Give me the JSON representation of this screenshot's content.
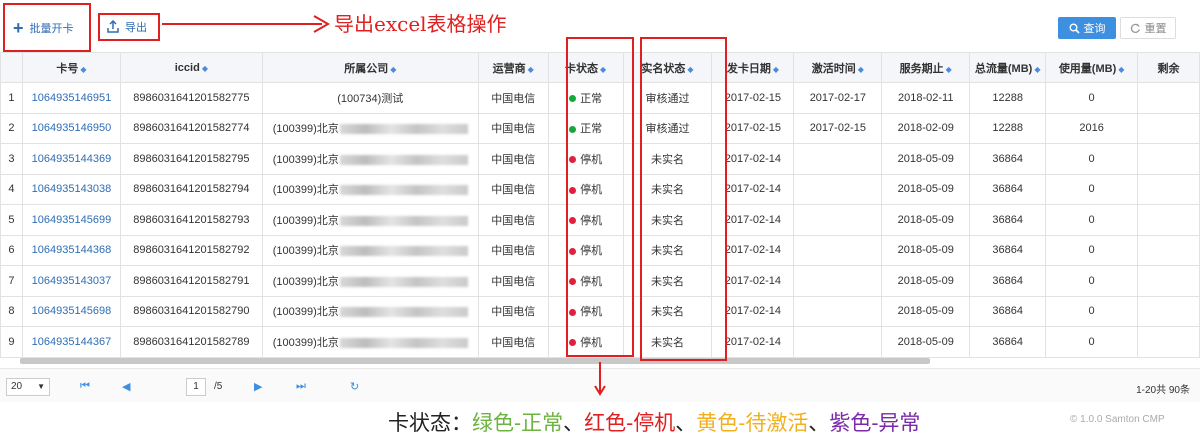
{
  "toolbar": {
    "bulk_open_label": "批量开卡",
    "export_label": "导出",
    "query_label": "查询",
    "reset_label": "重置"
  },
  "annotation": {
    "export_note": "导出excel表格操作"
  },
  "table": {
    "columns": [
      "卡号",
      "iccid",
      "所属公司",
      "运营商",
      "卡状态",
      "实名状态",
      "发卡日期",
      "激活时间",
      "服务期止",
      "总流量(MB)",
      "使用量(MB)",
      "剩余"
    ],
    "rows": [
      {
        "idx": "1",
        "card": "1064935146951",
        "iccid": "89860316412015​82775",
        "company": "(100734)测试",
        "redacted": false,
        "carrier": "中国电信",
        "status": "正常",
        "status_color": "#1aa63a",
        "realname": "审核通过",
        "issue": "2017-02-15",
        "active": "2017-02-17",
        "expire": "2018-02-11",
        "total": "12288",
        "used": "0"
      },
      {
        "idx": "2",
        "card": "1064935146950",
        "iccid": "898603164120158​2774",
        "company": "(100399)北京",
        "redacted": true,
        "carrier": "中国电信",
        "status": "正常",
        "status_color": "#1aa63a",
        "realname": "审核通过",
        "issue": "2017-02-15",
        "active": "2017-02-15",
        "expire": "2018-02-09",
        "total": "12288",
        "used": "2016"
      },
      {
        "idx": "3",
        "card": "1064935144369",
        "iccid": "8986031641201582795",
        "company": "(100399)北京",
        "redacted": true,
        "carrier": "中国电信",
        "status": "停机",
        "status_color": "#e0203c",
        "realname": "未实名",
        "issue": "2017-02-14",
        "active": "",
        "expire": "2018-05-09",
        "total": "36864",
        "used": "0"
      },
      {
        "idx": "4",
        "card": "1064935143038",
        "iccid": "8986031641201582794",
        "company": "(100399)北京",
        "redacted": true,
        "carrier": "中国电信",
        "status": "停机",
        "status_color": "#e0203c",
        "realname": "未实名",
        "issue": "2017-02-14",
        "active": "",
        "expire": "2018-05-09",
        "total": "36864",
        "used": "0"
      },
      {
        "idx": "5",
        "card": "1064935145699",
        "iccid": "8986031641201582793",
        "company": "(100399)北京",
        "redacted": true,
        "carrier": "中国电信",
        "status": "停机",
        "status_color": "#e0203c",
        "realname": "未实名",
        "issue": "2017-02-14",
        "active": "",
        "expire": "2018-05-09",
        "total": "36864",
        "used": "0"
      },
      {
        "idx": "6",
        "card": "1064935144368",
        "iccid": "8986031641201582792",
        "company": "(100399)北京",
        "redacted": true,
        "carrier": "中国电信",
        "status": "停机",
        "status_color": "#e0203c",
        "realname": "未实名",
        "issue": "2017-02-14",
        "active": "",
        "expire": "2018-05-09",
        "total": "36864",
        "used": "0"
      },
      {
        "idx": "7",
        "card": "1064935143037",
        "iccid": "8986031641201582791",
        "company": "(100399)北京",
        "redacted": true,
        "carrier": "中国电信",
        "status": "停机",
        "status_color": "#e0203c",
        "realname": "未实名",
        "issue": "2017-02-14",
        "active": "",
        "expire": "2018-05-09",
        "total": "36864",
        "used": "0"
      },
      {
        "idx": "8",
        "card": "1064935145698",
        "iccid": "8986031641201582790",
        "company": "(100399)北京",
        "redacted": true,
        "carrier": "中国电信",
        "status": "停机",
        "status_color": "#e0203c",
        "realname": "未实名",
        "issue": "2017-02-14",
        "active": "",
        "expire": "2018-05-09",
        "total": "36864",
        "used": "0"
      },
      {
        "idx": "9",
        "card": "1064935144367",
        "iccid": "8986031641201582789",
        "company": "(100399)北京",
        "redacted": true,
        "carrier": "中国电信",
        "status": "停机",
        "status_color": "#e0203c",
        "realname": "未实名",
        "issue": "2017-02-14",
        "active": "",
        "expire": "2018-05-09",
        "total": "36864",
        "used": "0"
      }
    ]
  },
  "pager": {
    "page_size": "20",
    "current_page": "1",
    "total_pages": "/5",
    "summary": "1-20共 90条"
  },
  "legend": {
    "prefix": "卡状态：",
    "items": [
      {
        "text": "绿色-正常",
        "color": "#6cb33f"
      },
      {
        "sep": "、"
      },
      {
        "text": "红色-停机",
        "color": "#e02020"
      },
      {
        "sep": "、"
      },
      {
        "text": "黄色-待激活",
        "color": "#f2b01e"
      },
      {
        "sep": "、"
      },
      {
        "text": "紫色-异常",
        "color": "#7a2aa8"
      }
    ]
  },
  "version": "© 1.0.0 Samton CMP",
  "colors": {
    "accent": "#3d8fe0",
    "link": "#2f6db5",
    "annotation_red": "#e02020"
  }
}
